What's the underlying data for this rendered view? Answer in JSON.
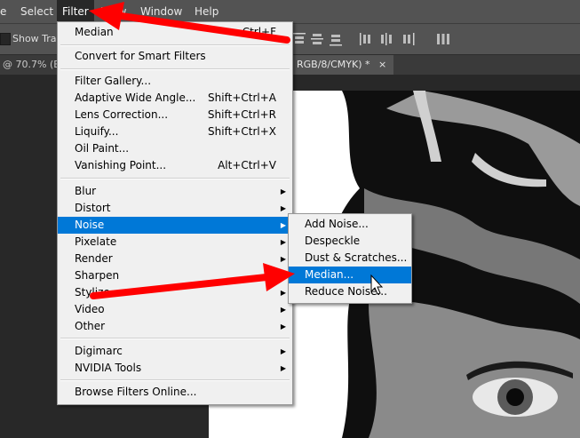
{
  "menubar": {
    "items": [
      "e",
      "Select",
      "Filter",
      "View",
      "Window",
      "Help"
    ]
  },
  "options_bar": {
    "show_transform_label": "Show Trans"
  },
  "document_tab": {
    "left_label": "@ 70.7% (Ba",
    "active_label": "RGB/8/CMYK) *",
    "close_glyph": "×"
  },
  "filter_menu": {
    "last_filter": {
      "label": "Median",
      "shortcut": "Ctrl+F"
    },
    "convert": "Convert for Smart Filters",
    "group2": [
      {
        "label": "Filter Gallery...",
        "shortcut": ""
      },
      {
        "label": "Adaptive Wide Angle...",
        "shortcut": "Shift+Ctrl+A"
      },
      {
        "label": "Lens Correction...",
        "shortcut": "Shift+Ctrl+R"
      },
      {
        "label": "Liquify...",
        "shortcut": "Shift+Ctrl+X"
      },
      {
        "label": "Oil Paint...",
        "shortcut": ""
      },
      {
        "label": "Vanishing Point...",
        "shortcut": "Alt+Ctrl+V"
      }
    ],
    "submenus": [
      "Blur",
      "Distort",
      "Noise",
      "Pixelate",
      "Render",
      "Sharpen",
      "Stylize",
      "Video",
      "Other"
    ],
    "plugins": [
      "Digimarc",
      "NVIDIA Tools"
    ],
    "browse": "Browse Filters Online..."
  },
  "noise_submenu": {
    "items": [
      "Add Noise...",
      "Despeckle",
      "Dust & Scratches...",
      "Median...",
      "Reduce Noise..."
    ],
    "highlighted": "Median..."
  },
  "submenu_arrow": "▶",
  "colors": {
    "highlight": "#0078d7",
    "annotation_arrow": "#ff0000",
    "menu_bg": "#f0f0f0",
    "chrome_bg": "#535353"
  }
}
